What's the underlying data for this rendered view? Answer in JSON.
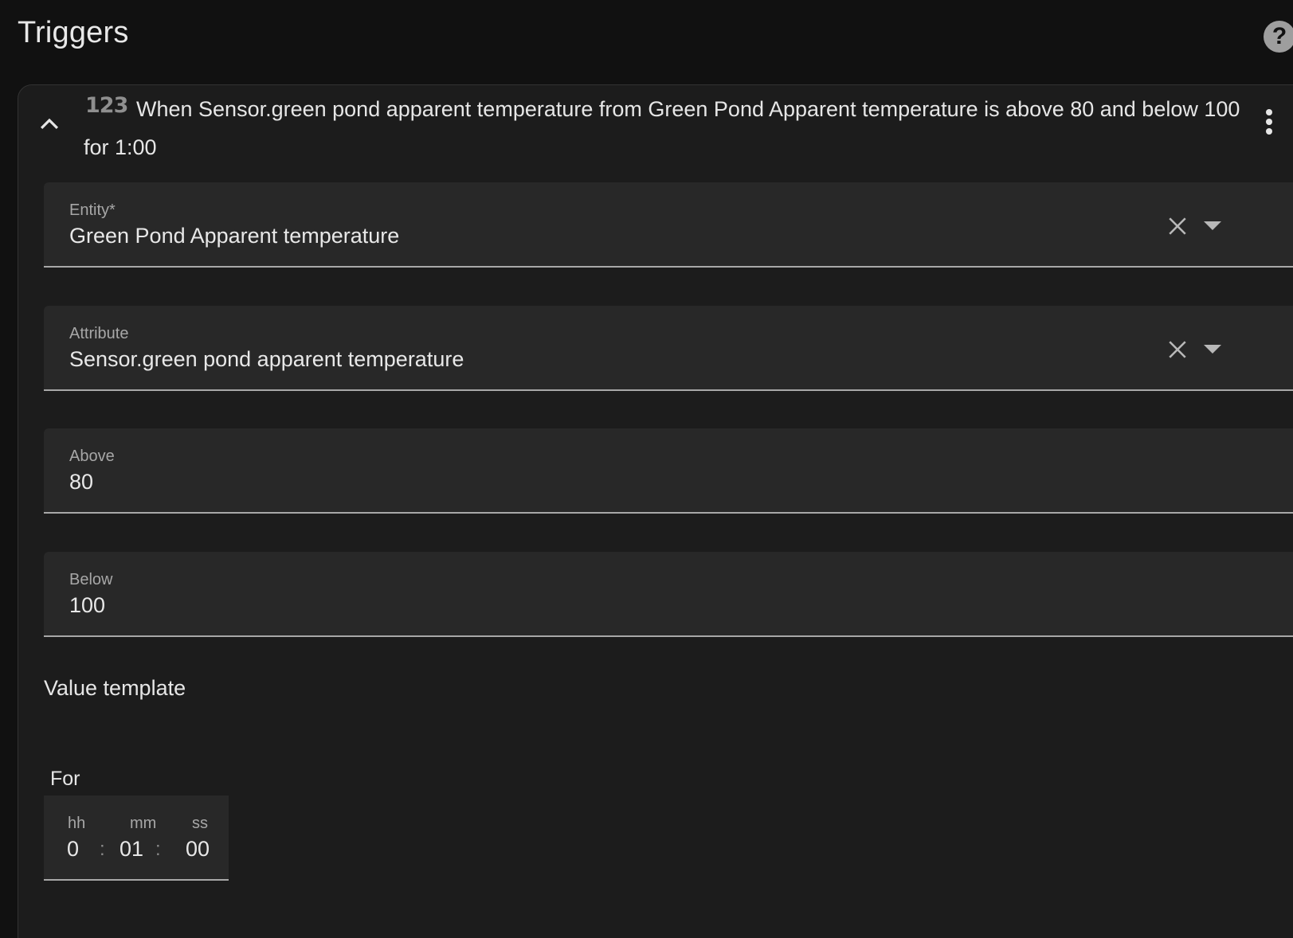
{
  "section": {
    "title": "Triggers",
    "help_icon": "help-circle-icon",
    "help_glyph": "?"
  },
  "trigger": {
    "type_icon_text": "123",
    "summary": "When Sensor.green pond apparent temperature from Green Pond Apparent temperature is above 80 and below 100 for 1:00",
    "collapse_icon": "chevron-up-icon",
    "menu_icon": "more-vertical-icon",
    "fields": {
      "entity": {
        "label": "Entity*",
        "value": "Green Pond Apparent temperature"
      },
      "attribute": {
        "label": "Attribute",
        "value": "Sensor.green pond apparent temperature"
      },
      "above": {
        "label": "Above",
        "value": "80"
      },
      "below": {
        "label": "Below",
        "value": "100"
      }
    },
    "value_template_label": "Value template",
    "for": {
      "label": "For",
      "hh_label": "hh",
      "mm_label": "mm",
      "ss_label": "ss",
      "hh": "0",
      "mm": "01",
      "ss": "00",
      "separator": ":"
    }
  },
  "colors": {
    "background": "#111111",
    "card": "#1c1c1c",
    "field": "#282828",
    "underline": "#a8a8a8",
    "text": "#e6e6e6",
    "muted_text": "#a7a7a7"
  }
}
